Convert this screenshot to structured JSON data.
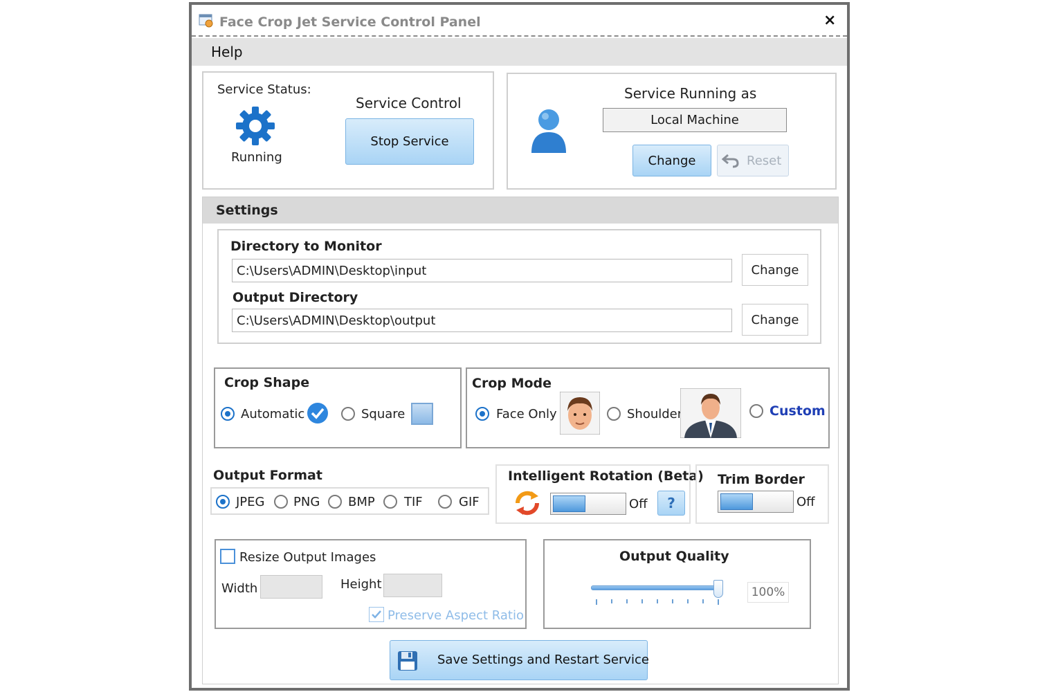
{
  "window": {
    "title": "Face Crop Jet Service Control Panel",
    "close": "×"
  },
  "menu": {
    "help": "Help"
  },
  "service": {
    "status_label": "Service Status:",
    "status_value": "Running",
    "control_label": "Service Control",
    "stop_button": "Stop Service"
  },
  "running_as": {
    "label": "Service Running as",
    "account": "Local Machine",
    "change_button": "Change",
    "reset_button": "Reset"
  },
  "settings": {
    "header": "Settings",
    "monitor_label": "Directory to Monitor",
    "monitor_path": "C:\\Users\\ADMIN\\Desktop\\input",
    "monitor_change": "Change",
    "output_label": "Output Directory",
    "output_path": "C:\\Users\\ADMIN\\Desktop\\output",
    "output_change": "Change"
  },
  "crop_shape": {
    "label": "Crop Shape",
    "options": [
      "Automatic",
      "Square"
    ],
    "selected": "Automatic"
  },
  "crop_mode": {
    "label": "Crop Mode",
    "options": [
      "Face Only",
      "Shoulder",
      "Custom"
    ],
    "selected": "Face Only"
  },
  "output_format": {
    "label": "Output Format",
    "options": [
      "JPEG",
      "PNG",
      "BMP",
      "TIF",
      "GIF"
    ],
    "selected": "JPEG"
  },
  "rotation": {
    "label": "Intelligent Rotation (Beta)",
    "state": "Off",
    "help": "?"
  },
  "trim": {
    "label": "Trim Border",
    "state": "Off"
  },
  "resize": {
    "label": "Resize Output Images",
    "width_label": "Width",
    "height_label": "Height",
    "preserve_label": "Preserve Aspect Ratio",
    "checked": false,
    "preserve_checked": true
  },
  "quality": {
    "label": "Output Quality",
    "value": "100%",
    "level": 1.0
  },
  "save_button": "Save Settings and Restart Service",
  "colors": {
    "accent": "#1c72c9",
    "button_blue": "#a9d4f5",
    "custom_link": "#1f3fb5"
  },
  "icons": [
    "app-icon",
    "gear-icon",
    "user-icon",
    "reset-arrow-icon",
    "checkmark-icon",
    "rotation-icon",
    "help-icon",
    "save-disk-icon"
  ]
}
